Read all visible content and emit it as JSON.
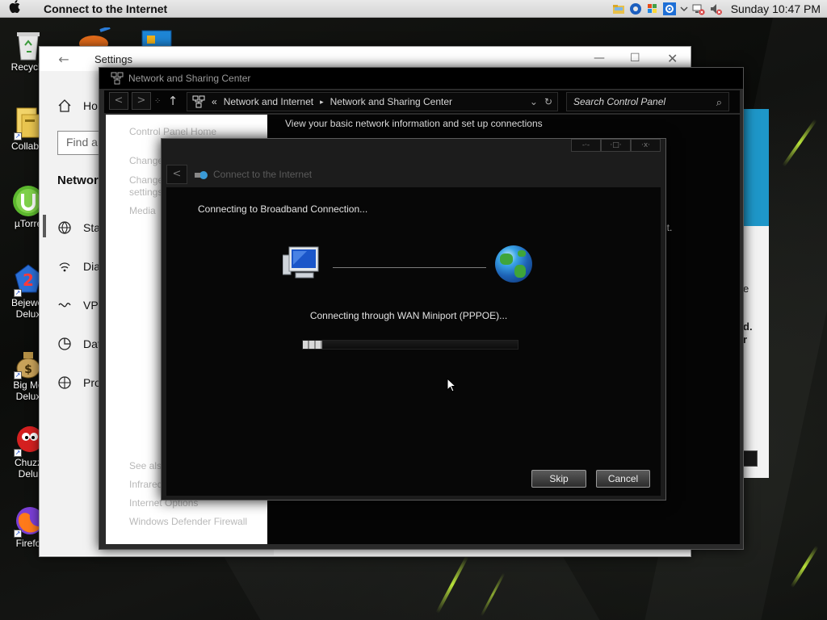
{
  "menubar": {
    "title": "Connect to the Internet",
    "clock": "Sunday 10:47 PM"
  },
  "desktop": {
    "icons": [
      {
        "label": "Recycle"
      },
      {
        "label": "CollabS"
      },
      {
        "label": "µTorre"
      },
      {
        "label": "Bejewel",
        "label2": "Delux"
      },
      {
        "label": "Big Mo",
        "label2": "Delux"
      },
      {
        "label": "Chuzz",
        "label2": "Delu"
      },
      {
        "label": "Firefo"
      }
    ]
  },
  "settings": {
    "title": "Settings",
    "home": "Ho",
    "find_placeholder": "Find a",
    "section_heading": "Network",
    "nav": [
      {
        "label": "Stat",
        "icon": "globe-icon"
      },
      {
        "label": "Dia",
        "icon": "dialup-icon"
      },
      {
        "label": "VPN",
        "icon": "vpn-icon"
      },
      {
        "label": "Dat",
        "icon": "data-usage-icon"
      },
      {
        "label": "Pro",
        "icon": "proxy-icon"
      }
    ]
  },
  "nsc": {
    "title": "Network and Sharing Center",
    "breadcrumb": {
      "root_sep": "«",
      "parent": "Network and Internet",
      "sep": "▸",
      "current": "Network and Sharing Center"
    },
    "search_placeholder": "Search Control Panel",
    "left_links": {
      "home": "Control Panel Home",
      "change1": "Change",
      "change2_line1": "Change",
      "change2_line2": "settings",
      "media": "Media",
      "see_also": "See also",
      "infrared": "Infrared",
      "internet_options": "Internet Options",
      "firewall": "Windows Defender Firewall"
    },
    "main_heading": "View your basic network information and set up connections",
    "right_fragments": {
      "nt": "nt.",
      "e": "e",
      "d": "d.",
      "r": "r"
    }
  },
  "dialog": {
    "title": "Connect to the Internet",
    "status": "Connecting to Broadband Connection...",
    "substatus": "Connecting through WAN Miniport (PPPOE)...",
    "progress_percent": 9,
    "buttons": {
      "skip": "Skip",
      "cancel": "Cancel"
    }
  }
}
